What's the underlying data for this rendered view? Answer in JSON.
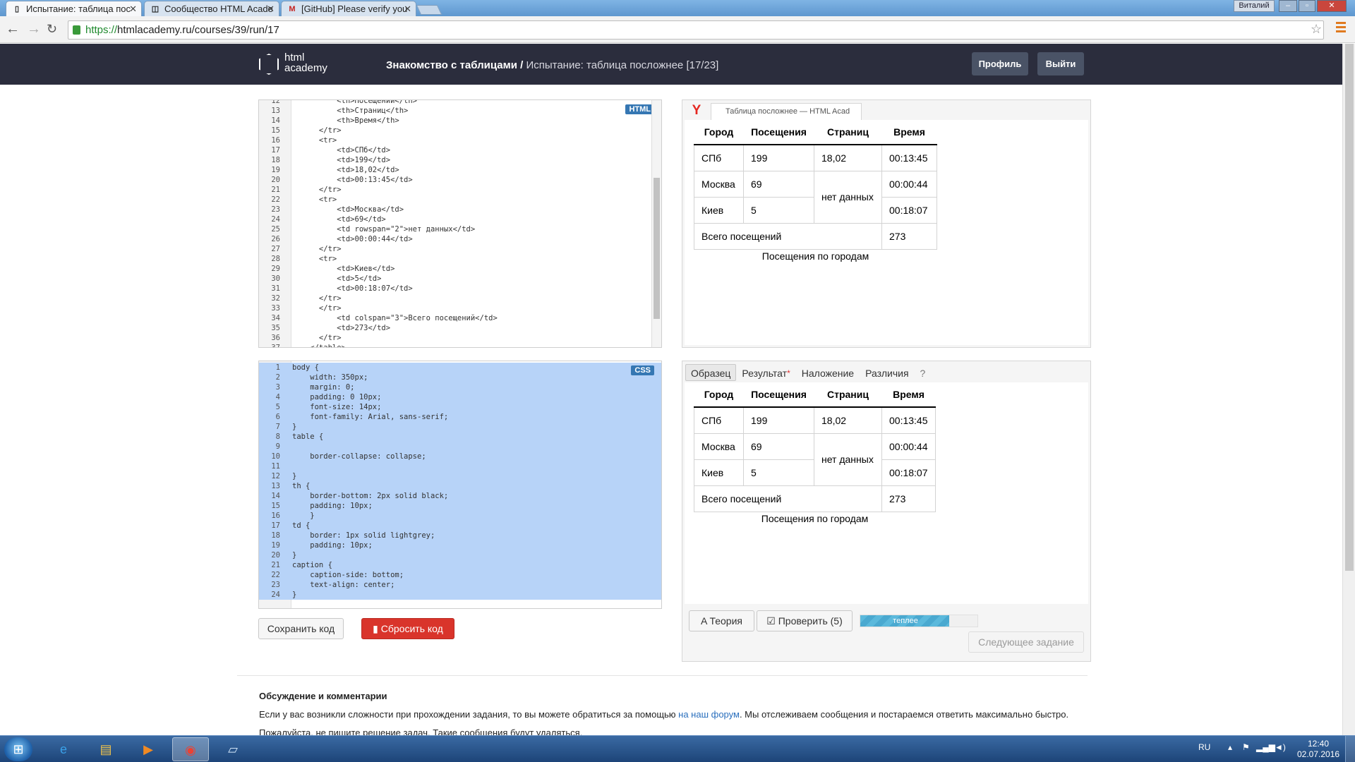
{
  "browser": {
    "tabs": [
      {
        "label": "Испытание: таблица пос",
        "icon": "bookmark-icon",
        "active": true
      },
      {
        "label": "Сообщество HTML Acade",
        "icon": "community-icon",
        "active": false
      },
      {
        "label": "[GitHub] Please verify you",
        "icon": "gmail-icon",
        "active": false
      }
    ],
    "close_glyph": "✕",
    "user": "Виталий",
    "url_scheme": "https://",
    "url_rest": "htmlacademy.ru/courses/39/run/17"
  },
  "site": {
    "logo_line1": "html",
    "logo_line2": "academy",
    "crumb_course": "Знакомство с таблицами",
    "crumb_sep": " / ",
    "crumb_current": "Испытание: таблица посложнее",
    "crumb_progress": "[17/23]",
    "profile_btn": "Профиль",
    "logout_btn": "Выйти"
  },
  "html_editor": {
    "badge": "HTML",
    "lines": [
      {
        "n": "12",
        "code": "          <th>Посещений</th>"
      },
      {
        "n": "13",
        "code": "          <th>Страниц</th>"
      },
      {
        "n": "14",
        "code": "          <th>Время</th>"
      },
      {
        "n": "15",
        "code": "      </tr>"
      },
      {
        "n": "16",
        "code": "      <tr>"
      },
      {
        "n": "17",
        "code": "          <td>СПб</td>"
      },
      {
        "n": "18",
        "code": "          <td>199</td>"
      },
      {
        "n": "19",
        "code": "          <td>18,02</td>"
      },
      {
        "n": "20",
        "code": "          <td>00:13:45</td>"
      },
      {
        "n": "21",
        "code": "      </tr>"
      },
      {
        "n": "22",
        "code": "      <tr>"
      },
      {
        "n": "23",
        "code": "          <td>Москва</td>"
      },
      {
        "n": "24",
        "code": "          <td>69</td>"
      },
      {
        "n": "25",
        "code": "          <td rowspan=\"2\">нет данных</td>"
      },
      {
        "n": "26",
        "code": "          <td>00:00:44</td>"
      },
      {
        "n": "27",
        "code": "      </tr>"
      },
      {
        "n": "28",
        "code": "      <tr>"
      },
      {
        "n": "29",
        "code": "          <td>Киев</td>"
      },
      {
        "n": "30",
        "code": "          <td>5</td>"
      },
      {
        "n": "31",
        "code": "          <td>00:18:07</td>"
      },
      {
        "n": "32",
        "code": "      </tr>"
      },
      {
        "n": "33",
        "code": "      </tr>"
      },
      {
        "n": "34",
        "code": "          <td colspan=\"3\">Всего посещений</td>"
      },
      {
        "n": "35",
        "code": "          <td>273</td>"
      },
      {
        "n": "36",
        "code": "      </tr>"
      },
      {
        "n": "37",
        "code": "    </table>"
      }
    ]
  },
  "css_editor": {
    "badge": "CSS",
    "lines": [
      {
        "n": "1",
        "code": "body {"
      },
      {
        "n": "2",
        "code": "    width: 350px;"
      },
      {
        "n": "3",
        "code": "    margin: 0;"
      },
      {
        "n": "4",
        "code": "    padding: 0 10px;"
      },
      {
        "n": "5",
        "code": "    font-size: 14px;"
      },
      {
        "n": "6",
        "code": "    font-family: Arial, sans-serif;"
      },
      {
        "n": "7",
        "code": "}"
      },
      {
        "n": "8",
        "code": "table {"
      },
      {
        "n": "9",
        "code": ""
      },
      {
        "n": "10",
        "code": "    border-collapse: collapse;"
      },
      {
        "n": "11",
        "code": ""
      },
      {
        "n": "12",
        "code": "}"
      },
      {
        "n": "13",
        "code": "th {"
      },
      {
        "n": "14",
        "code": "    border-bottom: 2px solid black;"
      },
      {
        "n": "15",
        "code": "    padding: 10px;"
      },
      {
        "n": "16",
        "code": "    }"
      },
      {
        "n": "17",
        "code": "td {"
      },
      {
        "n": "18",
        "code": "    border: 1px solid lightgrey;"
      },
      {
        "n": "19",
        "code": "    padding: 10px;"
      },
      {
        "n": "20",
        "code": "}"
      },
      {
        "n": "21",
        "code": "caption {"
      },
      {
        "n": "22",
        "code": "    caption-side: bottom;"
      },
      {
        "n": "23",
        "code": "    text-align: center;"
      },
      {
        "n": "24",
        "code": "}"
      }
    ]
  },
  "preview": {
    "tab_title": "Таблица посложнее — HTML Acad",
    "yandex_letter": "Y"
  },
  "result_table": {
    "headers": [
      "Город",
      "Посещения",
      "Страниц",
      "Время"
    ],
    "r1": [
      "СПб",
      "199",
      "18,02",
      "00:13:45"
    ],
    "r2": [
      "Москва",
      "69",
      "нет данных",
      "00:00:44"
    ],
    "r3": [
      "Киев",
      "5",
      "00:18:07"
    ],
    "total_label": "Всего посещений",
    "total_value": "273",
    "caption": "Посещения по городам"
  },
  "compare": {
    "tabs": [
      "Образец",
      "Результат",
      "Наложение",
      "Различия",
      "?"
    ],
    "asterisk": "*"
  },
  "actions": {
    "save": "Сохранить код",
    "reset": "Сбросить код",
    "theory": "Теория",
    "check": "Проверить (5)",
    "heat_label": "теплее",
    "heat_level": 0.76,
    "next": "Следующее задание"
  },
  "discussion": {
    "heading": "Обсуждение и комментарии",
    "text_before": "Если у вас возникли сложности при прохождении задания, то вы можете обратиться за помощью ",
    "link": "на наш форум",
    "text_after": ". Мы отслеживаем сообщения и постараемся ответить максимально быстро.",
    "text2": "Пожалуйста, не пишите решение задач. Такие сообщения будут удаляться."
  },
  "taskbar": {
    "start": "⊞",
    "lang": "RU",
    "time": "12:40",
    "date": "02.07.2016"
  },
  "colors": {
    "header_bg": "#2b2d3d",
    "selection": "#b7d3f8",
    "reset_red": "#d9342b"
  }
}
